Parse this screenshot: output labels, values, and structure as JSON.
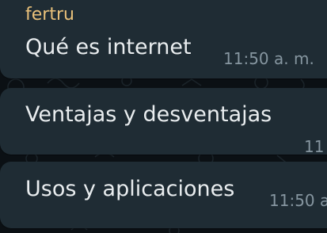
{
  "messages": [
    {
      "sender": "fertru",
      "text": "Qué es internet",
      "time": "11:50 a. m."
    },
    {
      "text": "Ventajas y desventajas",
      "time": "11"
    },
    {
      "text": "Usos y aplicaciones",
      "time": "11:50 a"
    }
  ],
  "colors": {
    "background": "#0b1014",
    "bubble": "#1f2c34",
    "sender": "#e8c07a",
    "text": "#e9edef",
    "time": "#8696a0"
  }
}
